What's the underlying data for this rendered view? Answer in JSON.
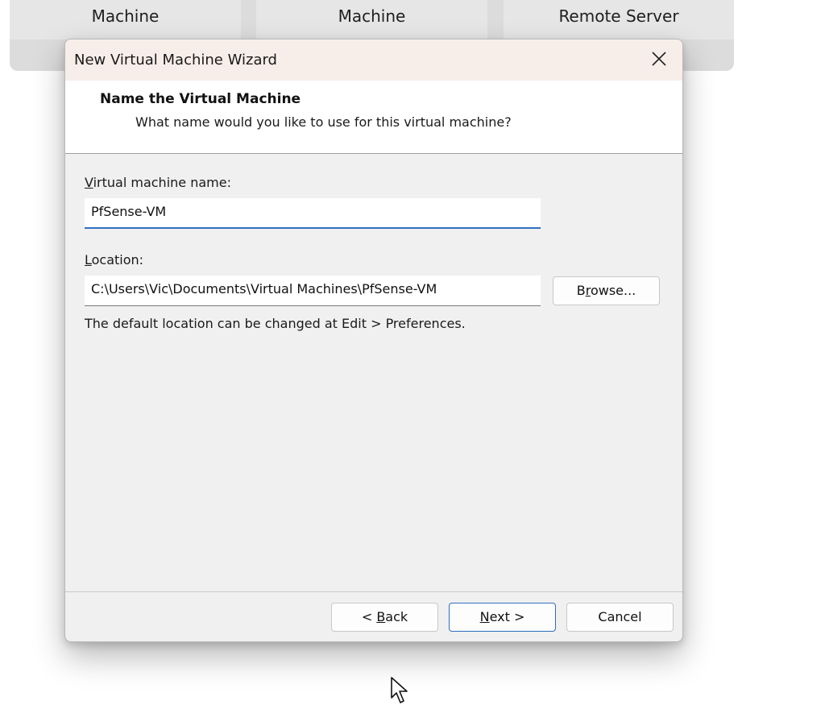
{
  "background": {
    "tiles": [
      {
        "label": "Machine"
      },
      {
        "label": "Machine"
      },
      {
        "label": "Remote Server"
      }
    ]
  },
  "dialog": {
    "title": "New Virtual Machine Wizard",
    "close_icon": "close-icon",
    "header": {
      "title": "Name the Virtual Machine",
      "subtitle": "What name would you like to use for this virtual machine?"
    },
    "name_field": {
      "label_accel": "V",
      "label_rest": "irtual machine name:",
      "value": "PfSense-VM"
    },
    "location_field": {
      "label_accel": "L",
      "label_rest": "ocation:",
      "value": "C:\\Users\\Vic\\Documents\\Virtual Machines\\PfSense-VM"
    },
    "browse_button": {
      "pre": "B",
      "accel": "r",
      "post": "owse..."
    },
    "hint": "The default location can be changed at Edit > Preferences.",
    "footer": {
      "back": {
        "pre": "< ",
        "accel": "B",
        "post": "ack"
      },
      "next": {
        "pre": "",
        "accel": "N",
        "post": "ext >"
      },
      "cancel": "Cancel"
    }
  },
  "colors": {
    "accent": "#2f6fc0",
    "titlebar": "#f7eeea",
    "dialog_bg": "#f0f0f0"
  }
}
